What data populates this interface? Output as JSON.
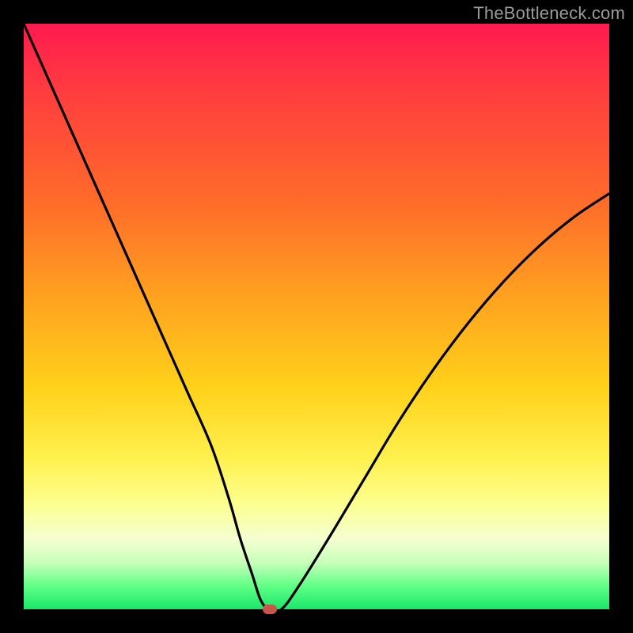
{
  "watermark": "TheBottleneck.com",
  "colors": {
    "frame": "#000000",
    "curve": "#000000",
    "marker": "#c9564b"
  },
  "chart_data": {
    "type": "line",
    "title": "",
    "xlabel": "",
    "ylabel": "",
    "xlim": [
      0,
      100
    ],
    "ylim": [
      0,
      100
    ],
    "grid": false,
    "legend": false,
    "series": [
      {
        "name": "bottleneck-curve",
        "x": [
          0,
          4,
          8,
          12,
          16,
          20,
          24,
          28,
          32,
          35,
          37,
          39,
          40.5,
          42,
          44,
          47,
          52,
          58,
          64,
          70,
          76,
          82,
          88,
          94,
          100
        ],
        "y": [
          100,
          91,
          82,
          73,
          64,
          55,
          46,
          37,
          28,
          19,
          12,
          6,
          1.5,
          0,
          0,
          4,
          12,
          22,
          32,
          41,
          49,
          56,
          62,
          67,
          71
        ]
      }
    ],
    "marker": {
      "x": 42,
      "y": 0
    },
    "background_gradient": [
      "#ff1a4f",
      "#ff3e3e",
      "#ff6a2a",
      "#ffa61f",
      "#ffd11a",
      "#fff04d",
      "#fcff8f",
      "#f5ffd0",
      "#c8ffba",
      "#61ff86",
      "#18e86a"
    ]
  }
}
